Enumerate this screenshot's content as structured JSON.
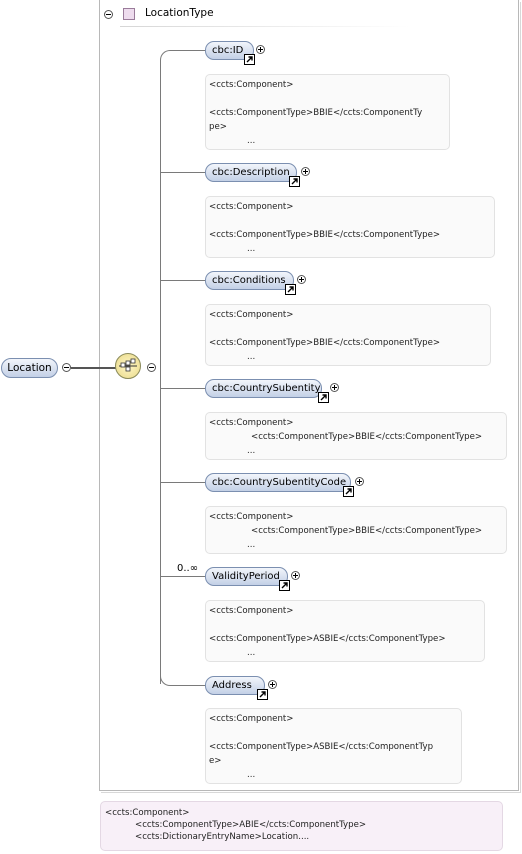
{
  "type_header": {
    "name": "LocationType"
  },
  "root": {
    "label": "Location"
  },
  "elements": [
    {
      "label": "cbc:ID",
      "anno": [
        "<ccts:Component>",
        "",
        "<ccts:ComponentType>BBIE</ccts:ComponentTy",
        "pe>",
        "        ..."
      ]
    },
    {
      "label": "cbc:Description",
      "anno": [
        "<ccts:Component>",
        "",
        "<ccts:ComponentType>BBIE</ccts:ComponentType>",
        "        ..."
      ]
    },
    {
      "label": "cbc:Conditions",
      "anno": [
        "<ccts:Component>",
        "",
        "<ccts:ComponentType>BBIE</ccts:ComponentType>",
        "        ..."
      ]
    },
    {
      "label": "cbc:CountrySubentity",
      "anno": [
        "<ccts:Component>",
        "        <ccts:ComponentType>BBIE</ccts:ComponentType>",
        "        ..."
      ]
    },
    {
      "label": "cbc:CountrySubentityCode",
      "anno": [
        "<ccts:Component>",
        "        <ccts:ComponentType>BBIE</ccts:ComponentType>",
        "        ..."
      ]
    },
    {
      "label": "ValidityPeriod",
      "cardinality": "0..∞",
      "anno": [
        "<ccts:Component>",
        "",
        "<ccts:ComponentType>ASBIE</ccts:ComponentType>",
        "        ..."
      ]
    },
    {
      "label": "Address",
      "anno": [
        "<ccts:Component>",
        "",
        "<ccts:ComponentType>ASBIE</ccts:ComponentTyp",
        "e>",
        "        ..."
      ]
    }
  ],
  "bottom_annotation": [
    "<ccts:Component>",
    "        <ccts:ComponentType>ABIE</ccts:ComponentType>",
    "        <ccts:DictionaryEntryName>Location...."
  ]
}
